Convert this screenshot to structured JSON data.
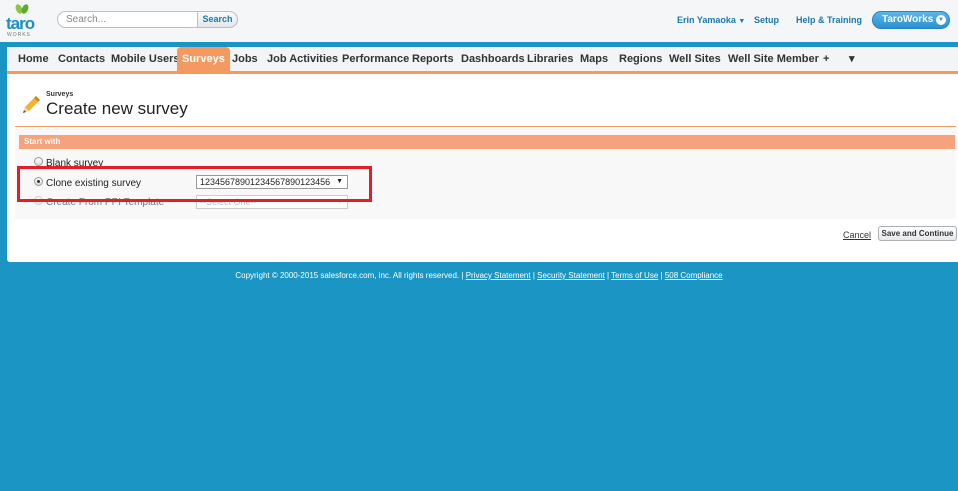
{
  "header": {
    "logo_text": "taro",
    "logo_sub": "WORKS",
    "search_placeholder": "Search...",
    "search_button": "Search",
    "user_name": "Erin Yamaoka",
    "setup": "Setup",
    "help": "Help & Training",
    "app_switcher": "TaroWorks"
  },
  "tabs": [
    {
      "label": "Home"
    },
    {
      "label": "Contacts"
    },
    {
      "label": "Mobile Users"
    },
    {
      "label": "Surveys",
      "active": true
    },
    {
      "label": "Jobs"
    },
    {
      "label": "Job Activities"
    },
    {
      "label": "Performance"
    },
    {
      "label": "Reports"
    },
    {
      "label": "Dashboards"
    },
    {
      "label": "Libraries"
    },
    {
      "label": "Maps"
    },
    {
      "label": "Regions"
    },
    {
      "label": "Well Sites"
    },
    {
      "label": "Well Site Member"
    },
    {
      "label": "+"
    },
    {
      "label": "▾"
    }
  ],
  "page": {
    "breadcrumb": "Surveys",
    "title": "Create new survey",
    "section_title": "Start with",
    "options": [
      {
        "label": "Blank survey",
        "selected": false
      },
      {
        "label": "Clone existing survey",
        "selected": true,
        "select_value": "12345678901234567890123456"
      },
      {
        "label": "Create From PPI Template",
        "selected": false,
        "select_value": "--Select One--"
      }
    ],
    "cancel": "Cancel",
    "save": "Save and Continue"
  },
  "footer": {
    "copyright": "Copyright © 2000-2015 salesforce.com, inc. All rights reserved. |",
    "privacy": "Privacy Statement",
    "security": "Security Statement",
    "terms": "Terms of Use",
    "compliance": "508 Compliance",
    "sep": "|"
  },
  "colors": {
    "accent": "#f49a61",
    "brand_blue": "#1b96c4",
    "highlight": "#e31e24"
  }
}
